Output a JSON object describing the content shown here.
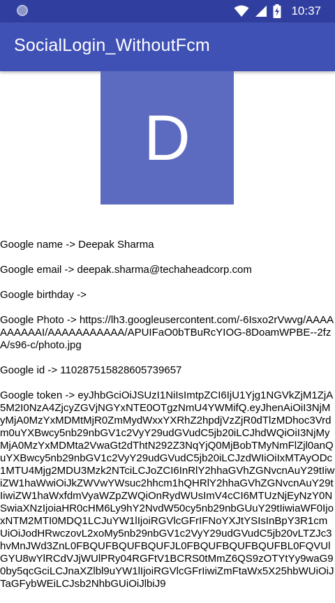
{
  "status_bar": {
    "time": "10:37"
  },
  "app_bar": {
    "title": "SocialLogin_WithoutFcm"
  },
  "profile": {
    "avatar_letter": "D"
  },
  "info": {
    "name": "Google name -> Deepak Sharma",
    "email": "Google email -> deepak.sharma@techaheadcorp.com",
    "birthday": "Google birthday ->",
    "photo": "Google Photo -> https://lh3.googleusercontent.com/-6Isxo2rVwvg/AAAAAAAAAAI/AAAAAAAAAAA/APUIFaO0bTBuRcYIOG-8DoamWPBE--2fzA/s96-c/photo.jpg",
    "id": "Google id -> 110287515828605739657",
    "token": "Google token -> eyJhbGciOiJSUzI1NiIsImtpZCI6IjU1Yjg1NGVkZjM1ZjA5M2I0NzA4ZjcyZGVjNGYxNTE0OTgzNmU4YWMifQ.eyJhenAiOiI3NjMyMjA0MzYxMDMtMjR0ZmMydWxxYXRhZ2hpdjVzZjR0dTlzMDhoc3Vrdm0uYXBwcy5nb29nbGV1c2VyY29udGVudC5jb20iLCJhdWQiOiI3NjMyMjA0MzYxMDMta2VwaGt2dThtN292Z3NqYjQ0MjBobTMyNmFlZjl0anQuYXBwcy5nb29nbGV1c2VyY29udGVudC5jb20iLCJzdWIiOiIxMTAyODc1MTU4Mjg2MDU3Mzk2NTciLCJoZCI6InRlY2hhaGVhZGNvcnAuY29tIiwiZW1haWwiOiJkZWVwYWsuc2hhcm1hQHRlY2hhaGVhZGNvcnAuY29tIiwiZW1haWxfdmVyaWZpZWQiOnRydWUsImV4cCI6MTUzNjEyNzY0NSwiaXNzIjoiaHR0cHM6Ly9hY2NvdW50cy5nb29nbGUuY29tIiwiaWF0IjoxNTM2MTI0MDQ1LCJuYW1lIjoiRGVlcGFrIFNoYXJtYSIsInBpY3R1cmUiOiJodHRwczovL2xoMy5nb29nbGV1c2VyY29udGVudC5jb20vLTZJc3hvMnJWd3ZnL0FBQUFBQUFBQUFJL0FBQUFBQUFBQUFBL0FQVUlGYU8wYlRCdVJjWUlPRy04RGFtV1BCRS0tMmZ6QS9zOTYtYy9waG90by5qcGciLCJnaXZlbl9uYW1lIjoiRGVlcGFrIiwiZmFtaWx5X25hbWUiOiJTaGFybWEiLCJsb2NhbGUiOiJlbiJ9"
  },
  "colors": {
    "status_bar": "#303F9F",
    "app_bar": "#3F51B5",
    "avatar_bg": "#5C6BC0"
  }
}
